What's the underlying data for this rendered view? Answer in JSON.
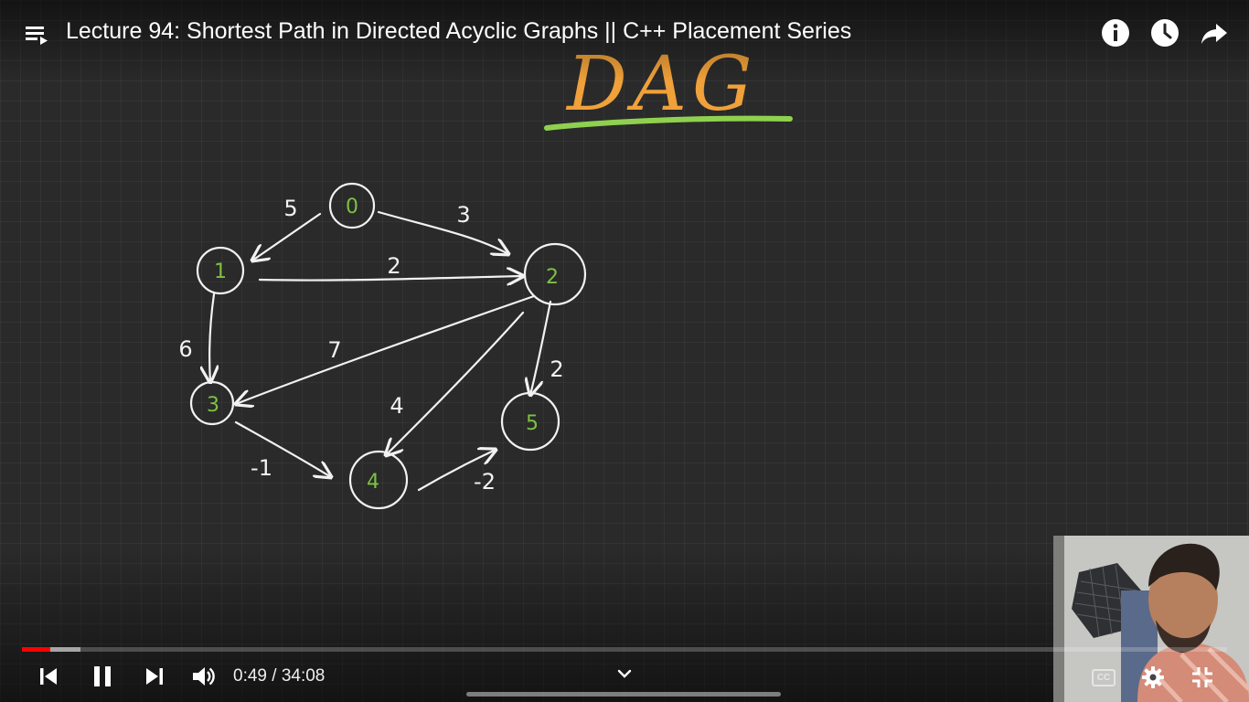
{
  "video": {
    "title": "Lecture 94: Shortest Path in Directed Acyclic Graphs || C++ Placement Series",
    "time_current": "0:49",
    "time_separator": "/",
    "time_total": "34:08",
    "progress_played_fraction": 0.0235,
    "progress_buffered_fraction": 0.0485
  },
  "top_bar": {
    "playlist_icon": "playlist-icon",
    "info_icon": "info-icon",
    "watch_later_icon": "clock-icon",
    "share_icon": "share-icon"
  },
  "controls": {
    "previous_icon": "previous-icon",
    "pause_icon": "pause-icon",
    "next_icon": "next-icon",
    "volume_icon": "volume-icon",
    "chevron_icon": "chevron-down-icon",
    "captions_label": "CC",
    "settings_icon": "gear-icon",
    "exit_fullscreen_icon": "exit-fullscreen-icon"
  },
  "whiteboard": {
    "heading": "DAG",
    "nodes": [
      {
        "id": "0",
        "label": "0"
      },
      {
        "id": "1",
        "label": "1"
      },
      {
        "id": "2",
        "label": "2"
      },
      {
        "id": "3",
        "label": "3"
      },
      {
        "id": "4",
        "label": "4"
      },
      {
        "id": "5",
        "label": "5"
      }
    ],
    "edges": [
      {
        "from": "0",
        "to": "1",
        "weight": "5"
      },
      {
        "from": "0",
        "to": "2",
        "weight": "3"
      },
      {
        "from": "1",
        "to": "2",
        "weight": "2"
      },
      {
        "from": "1",
        "to": "3",
        "weight": "6"
      },
      {
        "from": "2",
        "to": "3",
        "weight": "7"
      },
      {
        "from": "2",
        "to": "4",
        "weight": "4"
      },
      {
        "from": "2",
        "to": "5",
        "weight": "2"
      },
      {
        "from": "3",
        "to": "4",
        "weight": "-1"
      },
      {
        "from": "4",
        "to": "5",
        "weight": "-2"
      }
    ]
  },
  "colors": {
    "progress_played": "#ff0000",
    "heading_orange": "#f0a13a",
    "underline_green": "#8fd14f",
    "node_label_green": "#7dc143",
    "chalk_white": "#f2f2f2"
  }
}
